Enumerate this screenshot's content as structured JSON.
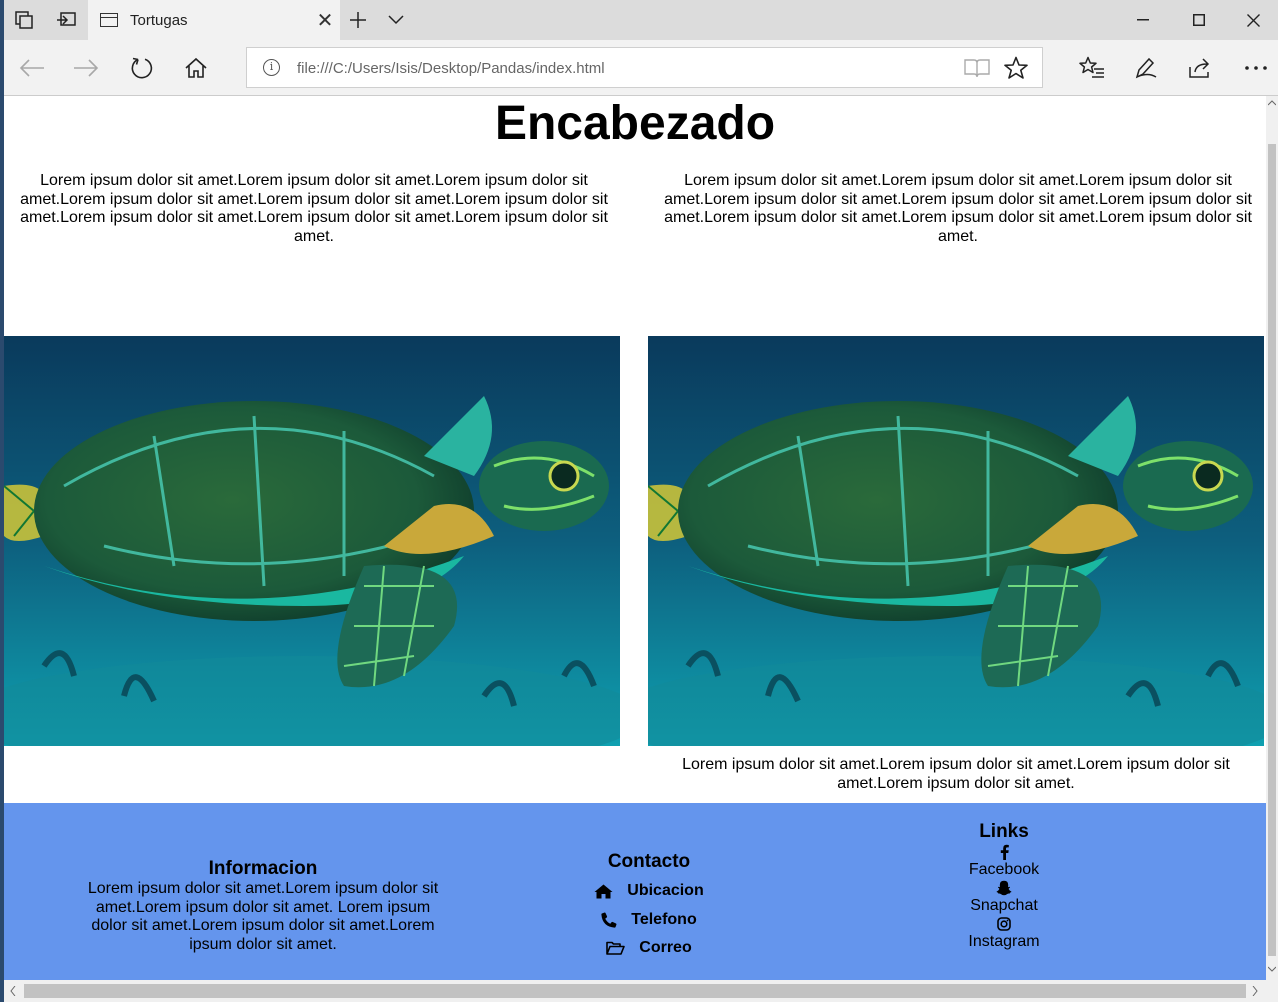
{
  "browser": {
    "tab_title": "Tortugas",
    "url": "file:///C:/Users/Isis/Desktop/Pandas/index.html"
  },
  "page": {
    "heading": "Encabezado",
    "left_text": "Lorem ipsum dolor sit amet.Lorem ipsum dolor sit amet.Lorem ipsum dolor sit amet.Lorem ipsum dolor sit amet.Lorem ipsum dolor sit amet.Lorem ipsum dolor sit amet.Lorem ipsum dolor sit amet.Lorem ipsum dolor sit amet.Lorem ipsum dolor sit amet.",
    "right_text": "Lorem ipsum dolor sit amet.Lorem ipsum dolor sit amet.Lorem ipsum dolor sit amet.Lorem ipsum dolor sit amet.Lorem ipsum dolor sit amet.Lorem ipsum dolor sit amet.Lorem ipsum dolor sit amet.Lorem ipsum dolor sit amet.Lorem ipsum dolor sit amet.",
    "image_caption": "Lorem ipsum dolor sit amet.Lorem ipsum dolor sit amet.Lorem ipsum dolor sit amet.Lorem ipsum dolor sit amet."
  },
  "footer": {
    "info": {
      "title": "Informacion",
      "text": "Lorem ipsum dolor sit amet.Lorem ipsum dolor sit amet.Lorem ipsum dolor sit amet. Lorem ipsum dolor sit amet.Lorem ipsum dolor sit amet.Lorem ipsum dolor sit amet."
    },
    "contact": {
      "title": "Contacto",
      "items": [
        {
          "label": "Ubicacion",
          "icon": "home-icon"
        },
        {
          "label": "Telefono",
          "icon": "phone-icon"
        },
        {
          "label": "Correo",
          "icon": "folder-open-icon"
        }
      ]
    },
    "links": {
      "title": "Links",
      "items": [
        {
          "label": "Facebook",
          "icon": "facebook-icon"
        },
        {
          "label": "Snapchat",
          "icon": "snapchat-icon"
        },
        {
          "label": "Instagram",
          "icon": "instagram-icon"
        }
      ]
    },
    "background": "#6495ed"
  }
}
